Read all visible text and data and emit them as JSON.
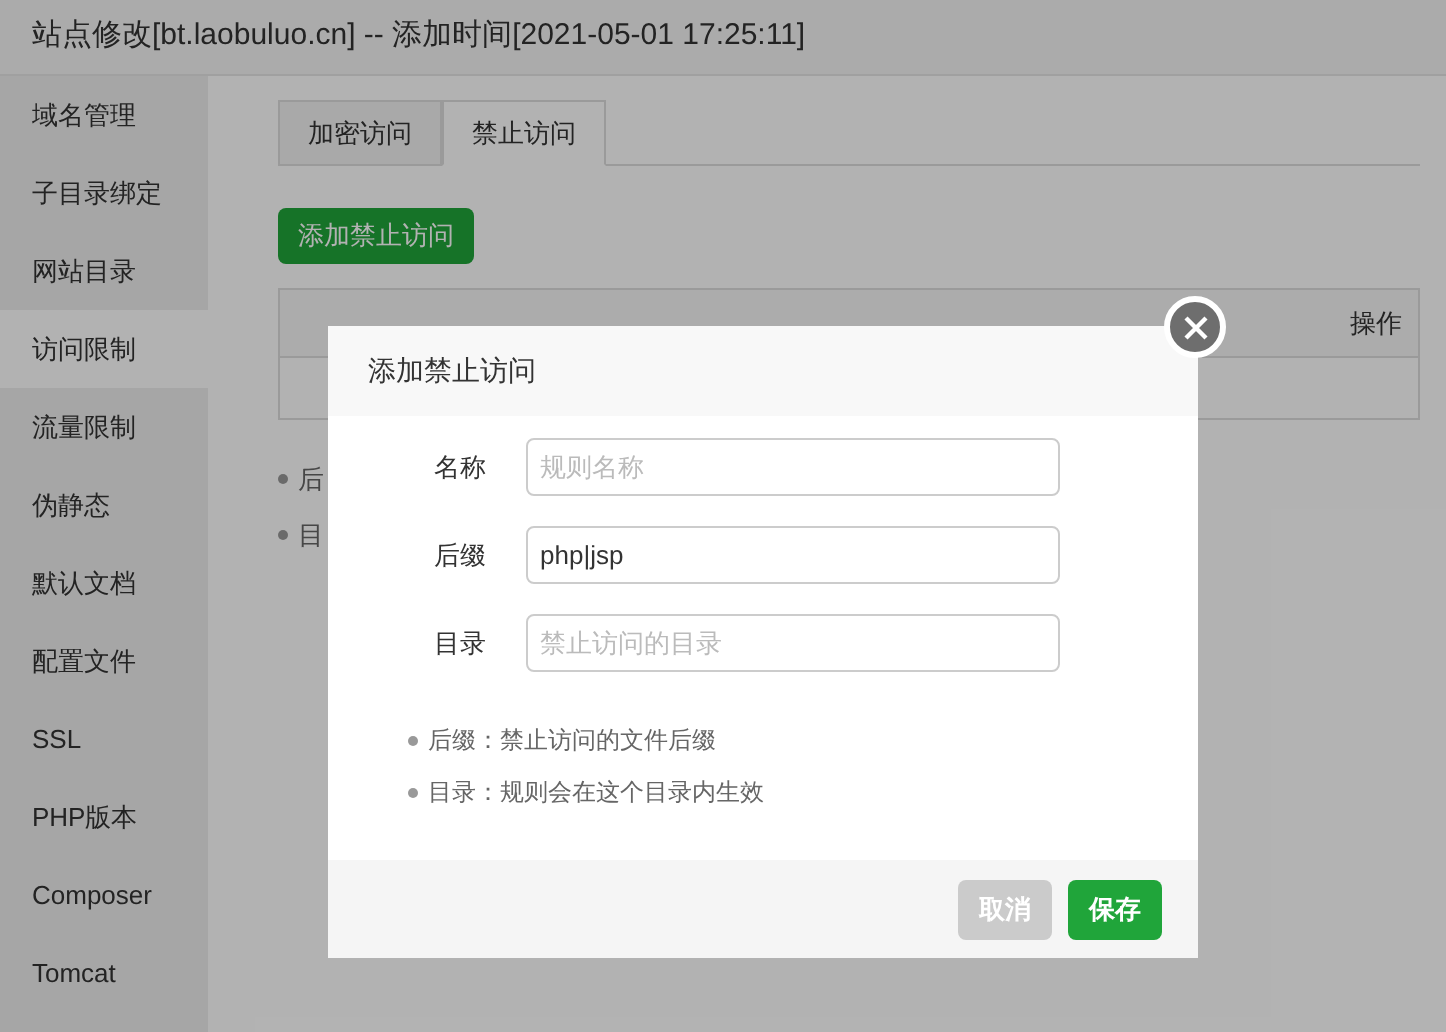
{
  "window": {
    "title": "站点修改[bt.laobuluo.cn] -- 添加时间[2021-05-01 17:25:11]"
  },
  "sidebar": {
    "items": [
      {
        "label": "域名管理",
        "selected": false
      },
      {
        "label": "子目录绑定",
        "selected": false
      },
      {
        "label": "网站目录",
        "selected": false
      },
      {
        "label": "访问限制",
        "selected": true
      },
      {
        "label": "流量限制",
        "selected": false
      },
      {
        "label": "伪静态",
        "selected": false
      },
      {
        "label": "默认文档",
        "selected": false
      },
      {
        "label": "配置文件",
        "selected": false
      },
      {
        "label": "SSL",
        "selected": false
      },
      {
        "label": "PHP版本",
        "selected": false
      },
      {
        "label": "Composer",
        "selected": false
      },
      {
        "label": "Tomcat",
        "selected": false
      }
    ]
  },
  "tabs": [
    {
      "label": "加密访问",
      "selected": false
    },
    {
      "label": "禁止访问",
      "selected": true
    }
  ],
  "add_button": "添加禁止访问",
  "table": {
    "columns": [
      "操作"
    ]
  },
  "notes": [
    "后",
    "目"
  ],
  "dialog": {
    "title": "添加禁止访问",
    "fields": [
      {
        "label": "名称",
        "placeholder": "规则名称"
      },
      {
        "label": "后缀",
        "value": "php|jsp"
      },
      {
        "label": "目录",
        "placeholder": "禁止访问的目录"
      }
    ],
    "hints": [
      "后缀：禁止访问的文件后缀",
      "目录：规则会在这个目录内生效"
    ],
    "buttons": [
      {
        "label": "取消",
        "kind": "cancel"
      },
      {
        "label": "保存",
        "kind": "primary"
      }
    ]
  }
}
